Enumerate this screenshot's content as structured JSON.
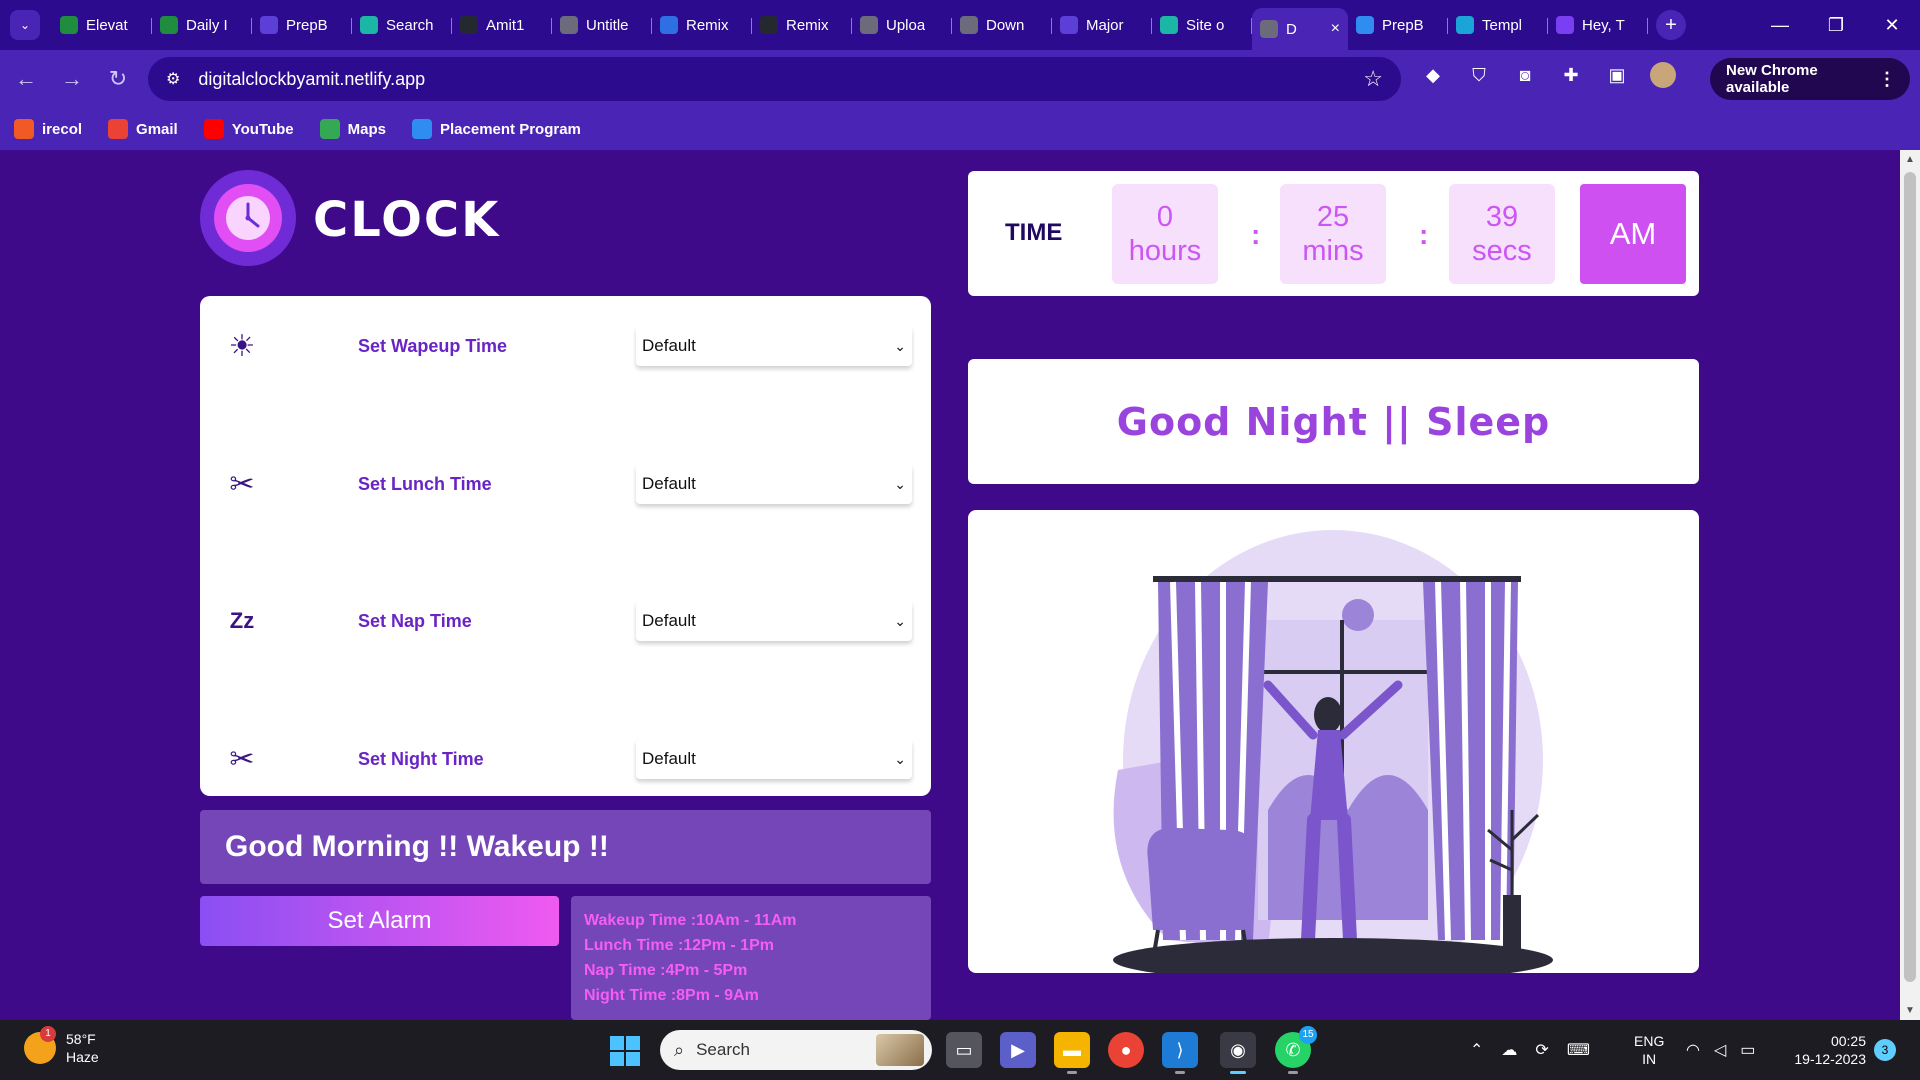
{
  "browser": {
    "tabs": [
      {
        "label": "Elevat",
        "icon": "sheets-icon",
        "color": "#1e8e3e"
      },
      {
        "label": "Daily I",
        "icon": "sheets-icon",
        "color": "#1e8e3e"
      },
      {
        "label": "PrepB",
        "icon": "doc-icon",
        "color": "#5b3fd6"
      },
      {
        "label": "Search",
        "icon": "vercel-icon",
        "color": "#1cb6a6"
      },
      {
        "label": "Amit1",
        "icon": "github-icon",
        "color": "#24292f"
      },
      {
        "label": "Untitle",
        "icon": "globe-icon",
        "color": "#6b6b7b"
      },
      {
        "label": "Remix",
        "icon": "remix-icon",
        "color": "#2f6fe4"
      },
      {
        "label": "Remix",
        "icon": "github-icon",
        "color": "#24292f"
      },
      {
        "label": "Uploa",
        "icon": "layers-icon",
        "color": "#6b6b7b"
      },
      {
        "label": "Down",
        "icon": "download-icon",
        "color": "#6b6b7b"
      },
      {
        "label": "Major",
        "icon": "doc-icon",
        "color": "#5b3fd6"
      },
      {
        "label": "Site o",
        "icon": "netlify-icon",
        "color": "#1cb6a6"
      },
      {
        "label": "D",
        "icon": "globe-icon",
        "color": "#6b6b7b",
        "active": true
      },
      {
        "label": "PrepB",
        "icon": "pb-icon",
        "color": "#2f8cf0"
      },
      {
        "label": "Templ",
        "icon": "canva-icon",
        "color": "#1aa4d8"
      },
      {
        "label": "Hey, T",
        "icon": "app-icon",
        "color": "#7a3ff2"
      }
    ],
    "tab_close": "×",
    "new_tab": "+",
    "window_controls": {
      "minimize": "—",
      "restore": "❐",
      "close": "✕"
    },
    "url": "digitalclockbyamit.netlify.app",
    "update_label": "New Chrome available",
    "bookmarks": [
      {
        "label": "irecol",
        "icon": "irecol-icon",
        "color": "#f15a24"
      },
      {
        "label": "Gmail",
        "icon": "gmail-icon",
        "color": "#ea4335"
      },
      {
        "label": "YouTube",
        "icon": "youtube-icon",
        "color": "#ff0000"
      },
      {
        "label": "Maps",
        "icon": "maps-icon",
        "color": "#34a853"
      },
      {
        "label": "Placement Program",
        "icon": "pb-icon",
        "color": "#2f8cf0"
      }
    ]
  },
  "app": {
    "brand": "CLOCK",
    "alarms": [
      {
        "label": "Set Wapeup Time",
        "icon": "sun-icon",
        "value": "Default"
      },
      {
        "label": "Set Lunch Time",
        "icon": "utensils-icon",
        "value": "Default"
      },
      {
        "label": "Set Nap Time",
        "icon": "zzz-icon",
        "value": "Default"
      },
      {
        "label": "Set Night Time",
        "icon": "utensils-icon",
        "value": "Default"
      }
    ],
    "greeting": "Good Morning !! Wakeup !!",
    "set_alarm_label": "Set Alarm",
    "schedule": [
      "Wakeup Time :10Am - 11Am",
      "Lunch Time :12Pm - 1Pm",
      "Nap Time :4Pm - 5Pm",
      "Night Time :8Pm - 9Am"
    ],
    "time": {
      "label": "TIME",
      "hours_value": "0",
      "hours_unit": "hours",
      "mins_value": "25",
      "mins_unit": "mins",
      "secs_value": "39",
      "secs_unit": "secs",
      "separator": ":",
      "ampm": "AM"
    },
    "message": "Good Night || Sleep",
    "colors": {
      "page_bg": "#3f0a8a",
      "accent_pink": "#cf50f0",
      "label_purple": "#6a24c4",
      "panel_purple": "#7446b8"
    }
  },
  "taskbar": {
    "weather_temp": "58°F",
    "weather_desc": "Haze",
    "weather_badge": "1",
    "search_label": "Search",
    "whatsapp_badge": "15",
    "lang_top": "ENG",
    "lang_bottom": "IN",
    "time": "00:25",
    "date": "19-12-2023",
    "notifications": "3"
  }
}
